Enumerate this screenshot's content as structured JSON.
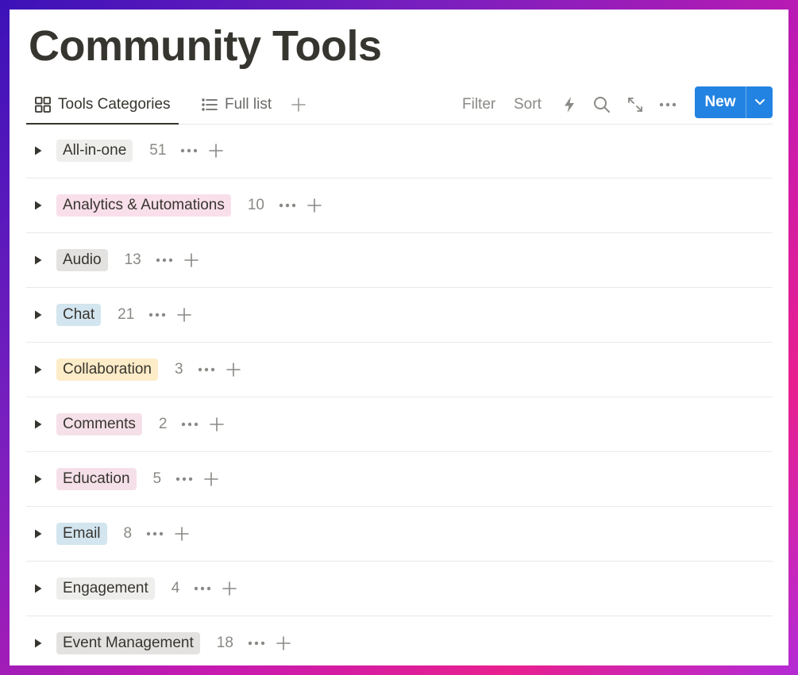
{
  "page": {
    "title": "Community Tools"
  },
  "tabs": [
    {
      "label": "Tools Categories",
      "icon": "gallery-icon",
      "active": true
    },
    {
      "label": "Full list",
      "icon": "list-icon",
      "active": false
    }
  ],
  "toolbar": {
    "filter_label": "Filter",
    "sort_label": "Sort",
    "new_label": "New",
    "icons": [
      "lightning-icon",
      "search-icon",
      "expand-icon",
      "more-horizontal-icon",
      "chevron-down-icon"
    ]
  },
  "groups": [
    {
      "label": "All-in-one",
      "count": "51",
      "color": "#eeeeed"
    },
    {
      "label": "Analytics & Automations",
      "count": "10",
      "color": "#f9dfea"
    },
    {
      "label": "Audio",
      "count": "13",
      "color": "#e3e2e0"
    },
    {
      "label": "Chat",
      "count": "21",
      "color": "#d3e5ef"
    },
    {
      "label": "Collaboration",
      "count": "3",
      "color": "#fdecc8"
    },
    {
      "label": "Comments",
      "count": "2",
      "color": "#f5e0e9"
    },
    {
      "label": "Education",
      "count": "5",
      "color": "#f5e0e9"
    },
    {
      "label": "Email",
      "count": "8",
      "color": "#d3e5ef"
    },
    {
      "label": "Engagement",
      "count": "4",
      "color": "#eeeeed"
    },
    {
      "label": "Event Management",
      "count": "18",
      "color": "#e3e2e0"
    }
  ]
}
